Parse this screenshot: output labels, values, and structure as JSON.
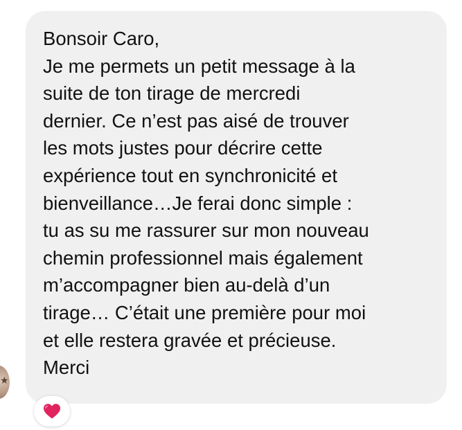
{
  "message": {
    "lines": [
      "Bonsoir Caro,",
      "Je me permets un petit message à la",
      "suite de ton tirage de mercredi",
      "dernier. Ce n’est pas aisé de trouver",
      "les mots justes pour décrire cette",
      "expérience tout en synchronicité et",
      "bienveillance…Je ferai donc simple  :",
      "tu as su me rassurer sur mon nouveau",
      "chemin professionnel mais également",
      "m’accompagner bien au-delà d’un",
      "tirage… C’était une première pour moi",
      "et elle restera gravée et précieuse.",
      "Merci"
    ]
  },
  "reaction": {
    "icon": "red-heart-icon",
    "color": "#e0245e"
  },
  "avatar": {
    "icon": "sender-avatar"
  },
  "colors": {
    "bubble_bg": "#f0f0f0",
    "text": "#111111"
  }
}
